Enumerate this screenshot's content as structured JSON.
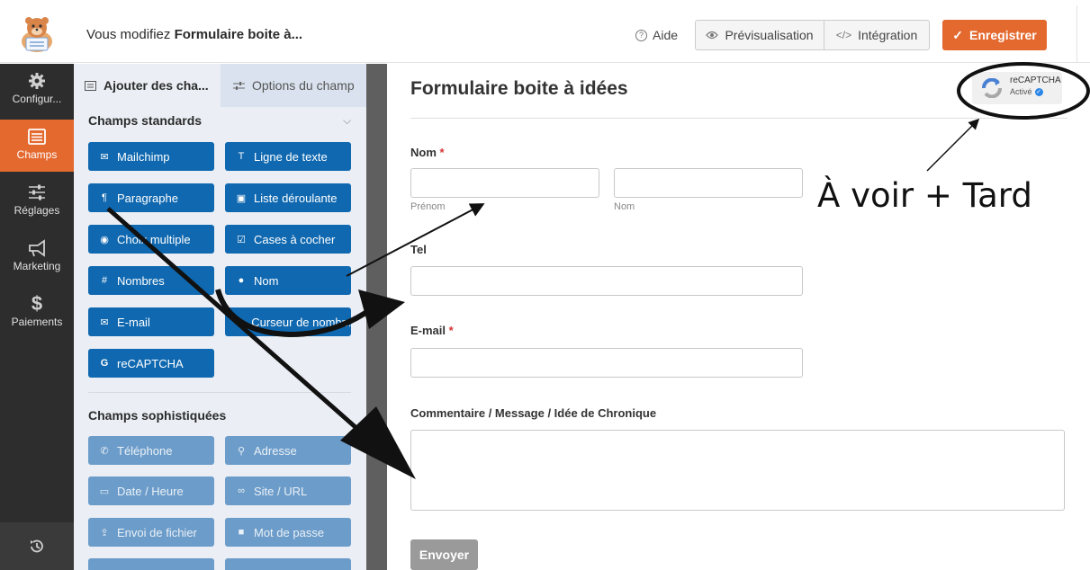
{
  "topbar": {
    "title_prefix": "Vous modifiez ",
    "title_form": "Formulaire boite à...",
    "help": "Aide",
    "preview": "Prévisualisation",
    "embed": "Intégration",
    "save": "Enregistrer"
  },
  "nav": {
    "items": [
      {
        "label": "Configur...",
        "icon": "gear-icon"
      },
      {
        "label": "Champs",
        "icon": "fields-icon"
      },
      {
        "label": "Réglages",
        "icon": "sliders-icon"
      },
      {
        "label": "Marketing",
        "icon": "megaphone-icon"
      },
      {
        "label": "Paiements",
        "icon": "dollar-icon"
      }
    ],
    "active": "Champs",
    "bottom_icon": "history-icon"
  },
  "panel": {
    "tab_add": "Ajouter des cha...",
    "tab_options": "Options du champ",
    "standard_title": "Champs standards",
    "standard_fields": [
      {
        "label": "Mailchimp",
        "icon": "envelope-icon"
      },
      {
        "label": "Ligne de texte",
        "icon": "text-icon"
      },
      {
        "label": "Paragraphe",
        "icon": "paragraph-icon"
      },
      {
        "label": "Liste déroulante",
        "icon": "dropdown-icon"
      },
      {
        "label": "Choix multiple",
        "icon": "radio-icon"
      },
      {
        "label": "Cases à cocher",
        "icon": "checkbox-icon"
      },
      {
        "label": "Nombres",
        "icon": "hash-icon"
      },
      {
        "label": "Nom",
        "icon": "user-icon"
      },
      {
        "label": "E-mail",
        "icon": "envelope-icon"
      },
      {
        "label": "Curseur de nombr...",
        "icon": "slider-icon"
      },
      {
        "label": "reCAPTCHA",
        "icon": "google-icon"
      }
    ],
    "fancy_title": "Champs sophistiquées",
    "fancy_fields": [
      {
        "label": "Téléphone",
        "icon": "phone-icon"
      },
      {
        "label": "Adresse",
        "icon": "map-pin-icon"
      },
      {
        "label": "Date / Heure",
        "icon": "calendar-icon"
      },
      {
        "label": "Site / URL",
        "icon": "link-icon"
      },
      {
        "label": "Envoi de fichier",
        "icon": "upload-icon"
      },
      {
        "label": "Mot de passe",
        "icon": "lock-icon"
      }
    ]
  },
  "form": {
    "title": "Formulaire boite à idées",
    "name_label": "Nom",
    "required_mark": "*",
    "first_sub": "Prénom",
    "last_sub": "Nom",
    "tel_label": "Tel",
    "email_label": "E-mail",
    "comment_label": "Commentaire / Message / Idée de Chronique",
    "submit": "Envoyer"
  },
  "recaptcha": {
    "title": "reCAPTCHA",
    "status": "Activé"
  },
  "annotation": "À voir + Tard",
  "colors": {
    "accent": "#e4692f",
    "field_button": "#0f68b0",
    "field_button_light": "#6c9cc9",
    "nav_bg": "#2d2d2d"
  }
}
